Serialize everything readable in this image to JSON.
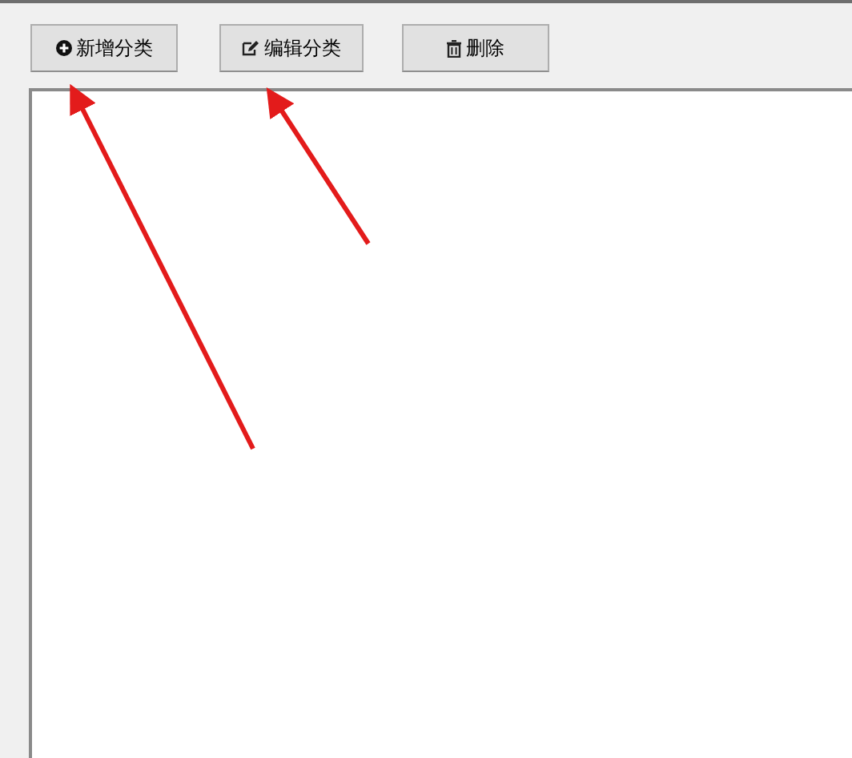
{
  "toolbar": {
    "buttons": [
      {
        "label": "新增分类"
      },
      {
        "label": "编辑分类"
      },
      {
        "label": "删除"
      }
    ]
  }
}
